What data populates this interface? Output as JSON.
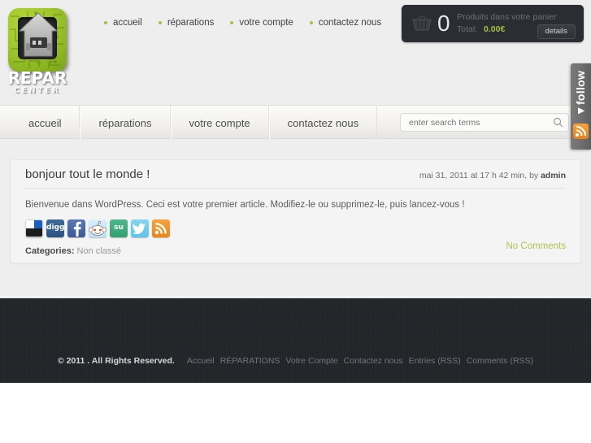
{
  "logo": {
    "line1": "REPAR",
    "line2": "CENTER",
    "icon": "house-plug-circuit-logo"
  },
  "topnav": {
    "items": [
      {
        "label": "accueil"
      },
      {
        "label": "réparations"
      },
      {
        "label": "votre compte"
      },
      {
        "label": "contactez nous"
      }
    ],
    "bullet_color": "#a7bf3e"
  },
  "cart": {
    "icon": "basket-icon",
    "count": "0",
    "products_text": "Produits dans votre panier",
    "total_label": "Total:",
    "total_value": "0.00€",
    "total_color": "#a7bf3e",
    "details_label": "details"
  },
  "mainnav": {
    "tabs": [
      {
        "label": "accueil"
      },
      {
        "label": "réparations"
      },
      {
        "label": "votre compte"
      },
      {
        "label": "contactez nous"
      }
    ]
  },
  "search": {
    "placeholder": "enter search terms",
    "value": "",
    "icon": "search-icon"
  },
  "follow": {
    "label": "follow",
    "arrow": "▼",
    "rss_icon": "rss-icon",
    "rss_color": "#ee8417"
  },
  "post": {
    "title": "bonjour tout le monde !",
    "meta_date": "mai 31, 2011 at 17 h 42 min, by ",
    "meta_author": "admin",
    "body": "Bienvenue dans WordPress. Ceci est votre premier article. Modifiez-le ou supprimez-le, puis lancez-vous !",
    "categories_label": "Categories:",
    "categories_value": "Non classé",
    "comments_label": "No Comments",
    "comments_color": "#b3c24e",
    "share": [
      {
        "name": "delicious-icon",
        "text": ""
      },
      {
        "name": "digg-icon",
        "text": "digg"
      },
      {
        "name": "facebook-icon",
        "text": "f"
      },
      {
        "name": "reddit-icon",
        "text": ""
      },
      {
        "name": "stumbleupon-icon",
        "text": "su"
      },
      {
        "name": "twitter-icon",
        "text": "t"
      },
      {
        "name": "rss-icon",
        "text": ""
      }
    ]
  },
  "footer": {
    "copyright": "© 2011 . All Rights Reserved.",
    "links": [
      {
        "label": "Accueil"
      },
      {
        "label": "RÉPARATIONS"
      },
      {
        "label": "Votre Compte"
      },
      {
        "label": "Contactez nous"
      },
      {
        "label": "Entries (RSS)"
      },
      {
        "label": "Comments (RSS)"
      }
    ]
  }
}
